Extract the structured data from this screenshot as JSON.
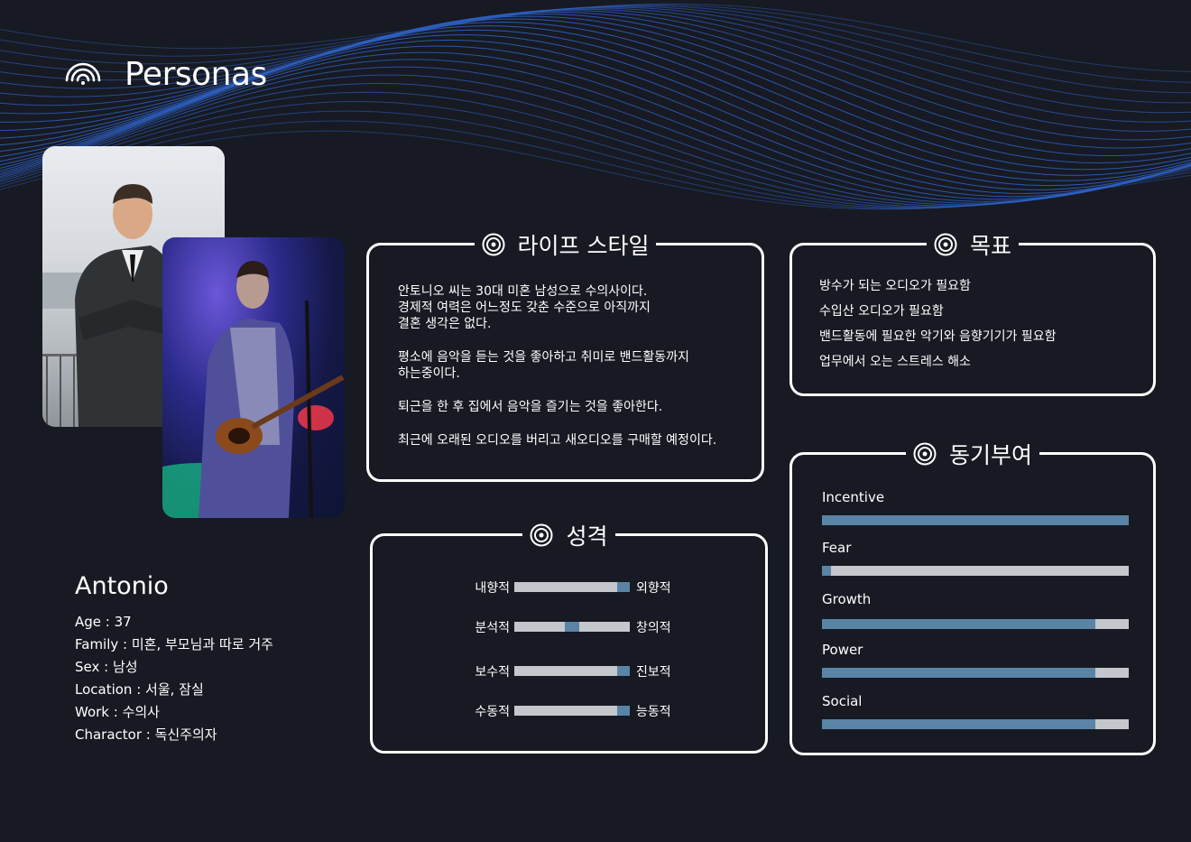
{
  "header": {
    "title": "Personas",
    "icon": "signal-arc-icon"
  },
  "profile": {
    "name": "Antonio",
    "rows": [
      {
        "label": "Age",
        "value": "37"
      },
      {
        "label": "Family",
        "value": "미혼, 부모님과 따로 거주"
      },
      {
        "label": "Sex",
        "value": "남성"
      },
      {
        "label": "Location",
        "value": "서울, 잠실"
      },
      {
        "label": "Work",
        "value": "수의사"
      },
      {
        "label": "Charactor",
        "value": "독신주의자"
      }
    ]
  },
  "lifestyle": {
    "title": "라이프 스타일",
    "paragraphs": [
      "안토니오 씨는 30대 미혼 남성으로 수의사이다.\n경제적 여력은 어느정도 갖춘 수준으로 아직까지\n결혼 생각은 없다.",
      "평소에 음악을 듣는 것을 좋아하고 취미로 밴드활동까지\n하는중이다.",
      "퇴근을 한 후 집에서 음악을 즐기는 것을 좋아한다.",
      "최근에 오래된 오디오를 버리고 새오디오를 구매할 예정이다."
    ]
  },
  "goals": {
    "title": "목표",
    "items": [
      "방수가 되는 오디오가 필요함",
      "수입산 오디오가 필요함",
      "밴드활동에 필요한 악기와 음향기기가 필요함",
      "업무에서 오는 스트레스 해소"
    ]
  },
  "personality": {
    "title": "성격",
    "traits": [
      {
        "left": "내향적",
        "right": "외향적",
        "from": 0.89,
        "to": 1.0
      },
      {
        "left": "분석적",
        "right": "창의적",
        "from": 0.44,
        "to": 0.56
      },
      {
        "left": "보수적",
        "right": "진보적",
        "from": 0.89,
        "to": 1.0
      },
      {
        "left": "수동적",
        "right": "능동적",
        "from": 0.89,
        "to": 1.0
      }
    ]
  },
  "motivation": {
    "title": "동기부여",
    "items": [
      {
        "label": "Incentive",
        "value": 1.0
      },
      {
        "label": "Fear",
        "value": 0.03
      },
      {
        "label": "Growth",
        "value": 0.89
      },
      {
        "label": "Power",
        "value": 0.89
      },
      {
        "label": "Social",
        "value": 0.89
      }
    ]
  },
  "colors": {
    "background": "#171a22",
    "accent": "#5a84a6",
    "track": "#c4c7cc",
    "wave": "#2e5fc2"
  }
}
